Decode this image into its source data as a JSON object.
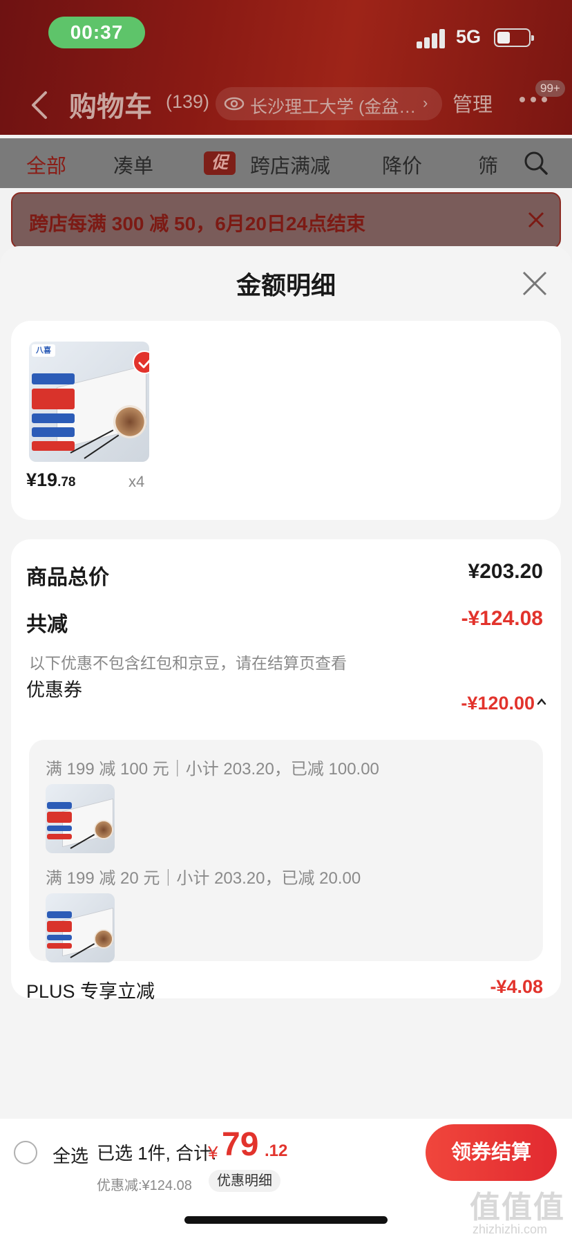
{
  "status_bar": {
    "time": "00:37",
    "network": "5G"
  },
  "nav": {
    "title": "购物车",
    "count": "(139)",
    "location": "长沙理工大学 (金盆…",
    "manage": "管理",
    "badge": "99+"
  },
  "filters": {
    "all": "全部",
    "bundle": "凑单",
    "promo_tag": "促",
    "cross_store": "跨店满减",
    "price_drop": "降价",
    "filter": "筛"
  },
  "promo_banner": {
    "text": "跨店每满 300 减 50，6月20日24点结束"
  },
  "sheet": {
    "title": "金额明细"
  },
  "product": {
    "price_int": "¥19",
    "price_dec": ".78",
    "quantity": "x4",
    "brand": "八喜"
  },
  "summary": {
    "total_label": "商品总价",
    "total_value": "¥203.20",
    "reduce_label": "共减",
    "reduce_value": "-¥124.08",
    "note": "以下优惠不包含红包和京豆，请在结算页查看",
    "coupon_label": "优惠券",
    "coupon_value": "-¥120.00",
    "coupons": [
      {
        "text": "满 199 减 100 元｜小计 203.20，已减 100.00"
      },
      {
        "text": "满 199 减 20 元｜小计 203.20，已减 20.00"
      }
    ],
    "plus_label": "PLUS 专享立减",
    "plus_value": "-¥4.08"
  },
  "footer": {
    "select_all": "全选",
    "selected_text": "已选 1件, 合计:",
    "currency": "¥",
    "total_int": "79",
    "total_dec": ".12",
    "discount_text": "优惠减:¥124.08",
    "detail_chip": "优惠明细",
    "checkout": "领券结算"
  },
  "watermark": {
    "main": "值值值",
    "sub": "zhizhizhi.com"
  },
  "colors": {
    "accent_red": "#e2332c",
    "header_red": "#8a1a14",
    "sheet_bg": "#f4f4f4"
  }
}
